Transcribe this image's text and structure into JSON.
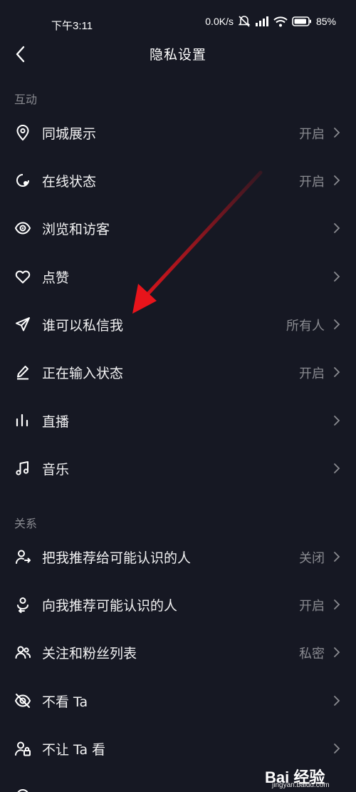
{
  "status_bar": {
    "time": "下午3:11",
    "speed": "0.0K/s",
    "battery": "85%"
  },
  "header": {
    "title": "隐私设置"
  },
  "sections": {
    "interaction": {
      "label": "互动",
      "items": [
        {
          "label": "同城展示",
          "value": "开启",
          "icon": "location-pin-icon"
        },
        {
          "label": "在线状态",
          "value": "开启",
          "icon": "online-status-icon"
        },
        {
          "label": "浏览和访客",
          "value": "",
          "icon": "eye-icon"
        },
        {
          "label": "点赞",
          "value": "",
          "icon": "heart-icon"
        },
        {
          "label": "谁可以私信我",
          "value": "所有人",
          "icon": "paper-plane-icon"
        },
        {
          "label": "正在输入状态",
          "value": "开启",
          "icon": "pen-icon"
        },
        {
          "label": "直播",
          "value": "",
          "icon": "bars-icon"
        },
        {
          "label": "音乐",
          "value": "",
          "icon": "music-note-icon"
        }
      ]
    },
    "relationship": {
      "label": "关系",
      "items": [
        {
          "label": "把我推荐给可能认识的人",
          "value": "关闭",
          "icon": "user-share-icon"
        },
        {
          "label": "向我推荐可能认识的人",
          "value": "开启",
          "icon": "user-suggest-icon"
        },
        {
          "label": "关注和粉丝列表",
          "value": "私密",
          "icon": "users-icon"
        },
        {
          "label": "不看 Ta",
          "value": "",
          "icon": "eye-off-icon"
        },
        {
          "label": "不让 Ta 看",
          "value": "",
          "icon": "user-lock-icon"
        }
      ]
    }
  },
  "watermark": {
    "logo": "Bai 经验",
    "site": "jingyan.baidu.com"
  },
  "colors": {
    "background": "#161823",
    "text_primary": "#f2f2f3",
    "text_secondary": "#8a8b91",
    "annotation_arrow": "#e8141b"
  }
}
